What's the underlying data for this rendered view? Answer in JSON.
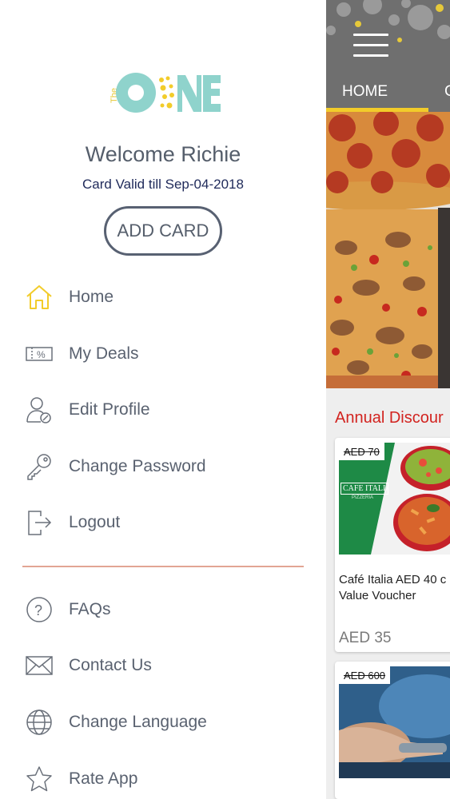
{
  "drawer": {
    "logo": {
      "prefix": "The",
      "word": "ONE"
    },
    "welcome": "Welcome Richie",
    "card_valid": "Card Valid till Sep-04-2018",
    "add_card_label": "ADD CARD",
    "menu": [
      {
        "label": "Home",
        "icon": "home-icon"
      },
      {
        "label": "My Deals",
        "icon": "deals-ticket-icon"
      },
      {
        "label": "Edit Profile",
        "icon": "edit-profile-icon"
      },
      {
        "label": "Change Password",
        "icon": "key-icon"
      },
      {
        "label": "Logout",
        "icon": "logout-icon"
      }
    ],
    "secondary_menu": [
      {
        "label": "FAQs",
        "icon": "question-icon"
      },
      {
        "label": "Contact Us",
        "icon": "envelope-icon"
      },
      {
        "label": "Change Language",
        "icon": "globe-icon"
      },
      {
        "label": "Rate App",
        "icon": "star-icon"
      }
    ]
  },
  "main": {
    "tabs": [
      {
        "label": "HOME",
        "active": true
      },
      {
        "label": "C",
        "active": false
      }
    ],
    "section_title": "Annual Discour",
    "deals": [
      {
        "old_price": "AED 70",
        "title_line1": "Café Italia AED 40 c",
        "title_line2": "Value Voucher",
        "price": "AED 35",
        "image_text": "CAFE ITALIA",
        "image_subtext": "PIZZERIA"
      },
      {
        "old_price": "AED 600"
      }
    ]
  },
  "colors": {
    "accent_yellow": "#f2cc2a",
    "logo_teal": "#8fd3cc",
    "section_red": "#d2231f",
    "menu_text": "#5a6270",
    "divider": "#e2a594"
  }
}
